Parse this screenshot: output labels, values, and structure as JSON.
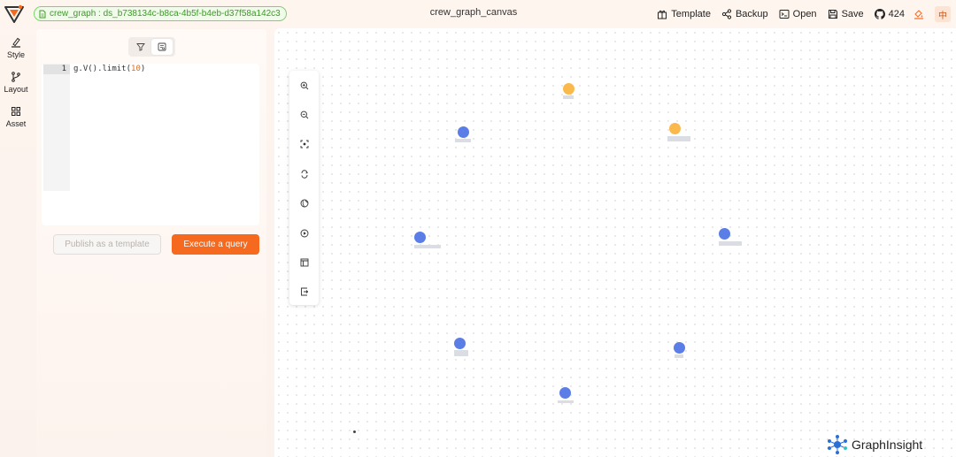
{
  "app": {
    "dataset_label": "crew_graph : ds_b738134c-b8ca-4b5f-b4eb-d37f58a142c3",
    "canvas_title": "crew_graph_canvas"
  },
  "header_actions": {
    "template": "Template",
    "backup": "Backup",
    "open": "Open",
    "save": "Save",
    "github_stars": "424",
    "language": "中"
  },
  "leftnav": [
    {
      "label": "Style",
      "icon": "brush-icon"
    },
    {
      "label": "Layout",
      "icon": "branch-icon"
    },
    {
      "label": "Asset",
      "icon": "grid-icon"
    }
  ],
  "editor": {
    "line_number": "1",
    "code_prefix": "g.V().limit(",
    "code_number": "10",
    "code_suffix": ")"
  },
  "buttons": {
    "publish": "Publish as a template",
    "execute": "Execute a query"
  },
  "canvas_tools": [
    "zoom-in-icon",
    "zoom-out-icon",
    "fit-view-icon",
    "switch-icon",
    "globe-icon",
    "play-icon",
    "layout-icon",
    "export-icon"
  ],
  "brand": "GraphInsight",
  "colors": {
    "accent": "#f56a1f",
    "node_blue": "#5a7de6",
    "node_orange": "#fbb94b",
    "badge_green": "#3a9b25"
  }
}
